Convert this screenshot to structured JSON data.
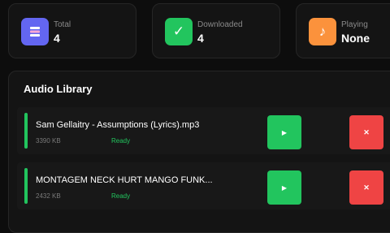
{
  "stats": [
    {
      "label": "Total",
      "value": "4",
      "icon": "stack-icon",
      "color": "#6366f1",
      "glyph": "≡"
    },
    {
      "label": "Downloaded",
      "value": "4",
      "icon": "checkmark-icon",
      "color": "#22c55e",
      "glyph": "✓"
    },
    {
      "label": "Playing",
      "value": "None",
      "icon": "music-note-icon",
      "color": "#fb923c",
      "glyph": "♪"
    }
  ],
  "library": {
    "title": "Audio Library",
    "tracks": [
      {
        "title": "Sam Gellaitry - Assumptions (Lyrics).mp3",
        "size": "3390 KB",
        "status": "Ready",
        "play_glyph": "▶",
        "delete_glyph": "✕"
      },
      {
        "title": "MONTAGEM NECK HURT MANGO FUNK...",
        "size": "2432 KB",
        "status": "Ready",
        "play_glyph": "▶",
        "delete_glyph": "✕"
      }
    ]
  },
  "colors": {
    "accent_green": "#22c55e",
    "accent_red": "#ef4444",
    "accent_indigo": "#6366f1",
    "accent_orange": "#fb923c"
  }
}
